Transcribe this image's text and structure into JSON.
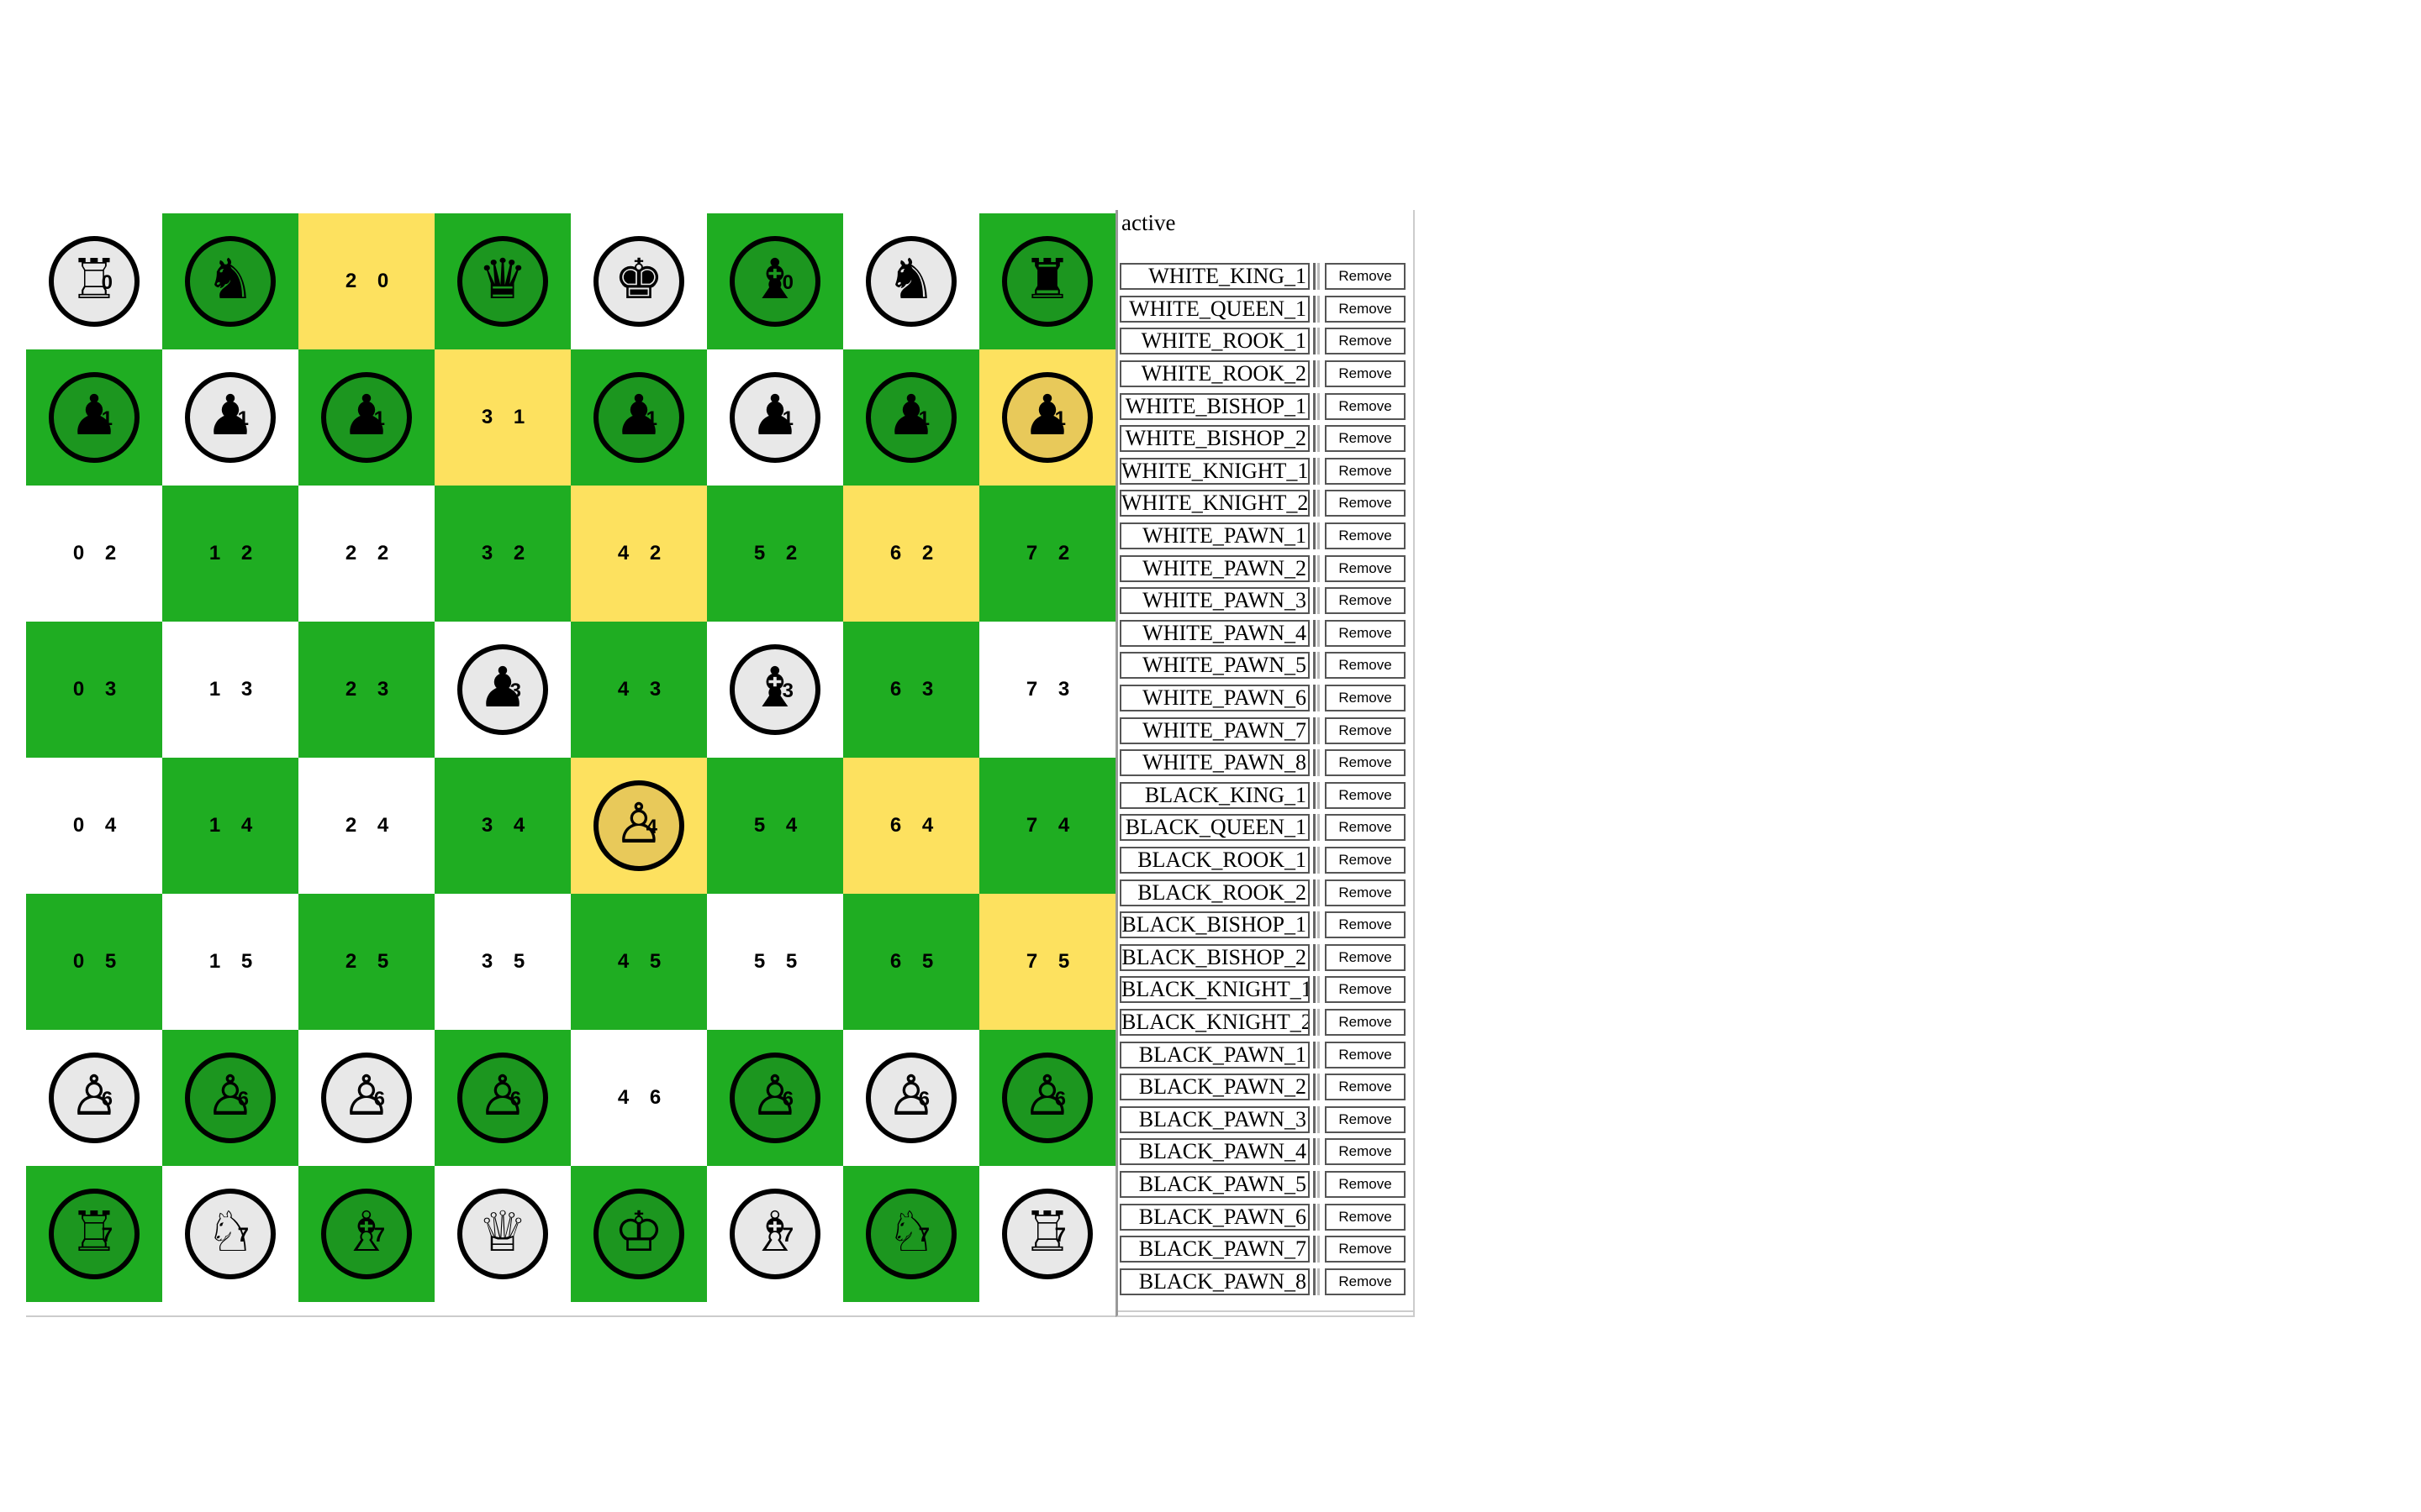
{
  "board": {
    "rows": [
      [
        {
          "bg": "white",
          "piece": {
            "glyph": "♖",
            "tone": "light",
            "tag": "0"
          }
        },
        {
          "bg": "green",
          "piece": {
            "glyph": "♞",
            "tone": "dark",
            "tag": ""
          }
        },
        {
          "bg": "yellow",
          "label": "2 0"
        },
        {
          "bg": "green",
          "piece": {
            "glyph": "♛",
            "tone": "dark",
            "tag": ""
          }
        },
        {
          "bg": "white",
          "piece": {
            "glyph": "♚",
            "tone": "light",
            "tag": ""
          }
        },
        {
          "bg": "green",
          "piece": {
            "glyph": "♝",
            "tone": "dark",
            "tag": "0"
          }
        },
        {
          "bg": "white",
          "piece": {
            "glyph": "♞",
            "tone": "light",
            "tag": ""
          }
        },
        {
          "bg": "green",
          "piece": {
            "glyph": "♜",
            "tone": "dark",
            "tag": ""
          }
        }
      ],
      [
        {
          "bg": "green",
          "piece": {
            "glyph": "♟",
            "tone": "dark",
            "tag": "1"
          }
        },
        {
          "bg": "white",
          "piece": {
            "glyph": "♟",
            "tone": "light",
            "tag": "1"
          }
        },
        {
          "bg": "green",
          "piece": {
            "glyph": "♟",
            "tone": "dark",
            "tag": "1"
          }
        },
        {
          "bg": "yellow",
          "label": "3 1"
        },
        {
          "bg": "green",
          "piece": {
            "glyph": "♟",
            "tone": "dark",
            "tag": "1"
          }
        },
        {
          "bg": "white",
          "piece": {
            "glyph": "♟",
            "tone": "light",
            "tag": "1"
          }
        },
        {
          "bg": "green",
          "piece": {
            "glyph": "♟",
            "tone": "dark",
            "tag": "1"
          }
        },
        {
          "bg": "yellow",
          "piece": {
            "glyph": "♟",
            "tone": "gold",
            "tag": "1"
          }
        }
      ],
      [
        {
          "bg": "white",
          "label": "0 2"
        },
        {
          "bg": "green",
          "label": "1 2"
        },
        {
          "bg": "white",
          "label": "2 2"
        },
        {
          "bg": "green",
          "label": "3 2"
        },
        {
          "bg": "yellow",
          "label": "4 2"
        },
        {
          "bg": "green",
          "label": "5 2"
        },
        {
          "bg": "yellow",
          "label": "6 2"
        },
        {
          "bg": "green",
          "label": "7 2"
        }
      ],
      [
        {
          "bg": "green",
          "label": "0 3"
        },
        {
          "bg": "white",
          "label": "1 3"
        },
        {
          "bg": "green",
          "label": "2 3"
        },
        {
          "bg": "white",
          "piece": {
            "glyph": "♟",
            "tone": "light",
            "tag": "3"
          }
        },
        {
          "bg": "green",
          "label": "4 3"
        },
        {
          "bg": "white",
          "piece": {
            "glyph": "♝",
            "tone": "light",
            "tag": "3"
          }
        },
        {
          "bg": "green",
          "label": "6 3"
        },
        {
          "bg": "white",
          "label": "7 3"
        }
      ],
      [
        {
          "bg": "white",
          "label": "0 4"
        },
        {
          "bg": "green",
          "label": "1 4"
        },
        {
          "bg": "white",
          "label": "2 4"
        },
        {
          "bg": "green",
          "label": "3 4"
        },
        {
          "bg": "yellow",
          "piece": {
            "glyph": "♙",
            "tone": "gold",
            "tag": "4"
          }
        },
        {
          "bg": "green",
          "label": "5 4"
        },
        {
          "bg": "yellow",
          "label": "6 4"
        },
        {
          "bg": "green",
          "label": "7 4"
        }
      ],
      [
        {
          "bg": "green",
          "label": "0 5"
        },
        {
          "bg": "white",
          "label": "1 5"
        },
        {
          "bg": "green",
          "label": "2 5"
        },
        {
          "bg": "white",
          "label": "3 5"
        },
        {
          "bg": "green",
          "label": "4 5"
        },
        {
          "bg": "white",
          "label": "5 5"
        },
        {
          "bg": "green",
          "label": "6 5"
        },
        {
          "bg": "yellow",
          "label": "7 5"
        }
      ],
      [
        {
          "bg": "white",
          "piece": {
            "glyph": "♙",
            "tone": "light",
            "tag": "6"
          }
        },
        {
          "bg": "green",
          "piece": {
            "glyph": "♙",
            "tone": "dark",
            "tag": "6"
          }
        },
        {
          "bg": "white",
          "piece": {
            "glyph": "♙",
            "tone": "light",
            "tag": "6"
          }
        },
        {
          "bg": "green",
          "piece": {
            "glyph": "♙",
            "tone": "dark",
            "tag": "6"
          }
        },
        {
          "bg": "white",
          "label": "4 6"
        },
        {
          "bg": "green",
          "piece": {
            "glyph": "♙",
            "tone": "dark",
            "tag": "6"
          }
        },
        {
          "bg": "white",
          "piece": {
            "glyph": "♙",
            "tone": "light",
            "tag": "6"
          }
        },
        {
          "bg": "green",
          "piece": {
            "glyph": "♙",
            "tone": "dark",
            "tag": "6"
          }
        }
      ],
      [
        {
          "bg": "green",
          "piece": {
            "glyph": "♖",
            "tone": "dark",
            "tag": "7"
          }
        },
        {
          "bg": "white",
          "piece": {
            "glyph": "♘",
            "tone": "light",
            "tag": "7"
          }
        },
        {
          "bg": "green",
          "piece": {
            "glyph": "♗",
            "tone": "dark",
            "tag": "7"
          }
        },
        {
          "bg": "white",
          "piece": {
            "glyph": "♕",
            "tone": "light",
            "tag": ""
          }
        },
        {
          "bg": "green",
          "piece": {
            "glyph": "♔",
            "tone": "dark",
            "tag": ""
          }
        },
        {
          "bg": "white",
          "piece": {
            "glyph": "♗",
            "tone": "light",
            "tag": "7"
          }
        },
        {
          "bg": "green",
          "piece": {
            "glyph": "♘",
            "tone": "dark",
            "tag": "7"
          }
        },
        {
          "bg": "white",
          "piece": {
            "glyph": "♖",
            "tone": "light",
            "tag": "7"
          }
        }
      ]
    ]
  },
  "colors": {
    "green": "#1fad22",
    "yellow": "#fde15f",
    "white": "#ffffff"
  },
  "panel": {
    "title": "active",
    "remove_label": "Remove",
    "pieces": [
      "WHITE_KING_1",
      "WHITE_QUEEN_1",
      "WHITE_ROOK_1",
      "WHITE_ROOK_2",
      "WHITE_BISHOP_1",
      "WHITE_BISHOP_2",
      "WHITE_KNIGHT_1",
      "WHITE_KNIGHT_2",
      "WHITE_PAWN_1",
      "WHITE_PAWN_2",
      "WHITE_PAWN_3",
      "WHITE_PAWN_4",
      "WHITE_PAWN_5",
      "WHITE_PAWN_6",
      "WHITE_PAWN_7",
      "WHITE_PAWN_8",
      "BLACK_KING_1",
      "BLACK_QUEEN_1",
      "BLACK_ROOK_1",
      "BLACK_ROOK_2",
      "BLACK_BISHOP_1",
      "BLACK_BISHOP_2",
      "BLACK_KNIGHT_1",
      "BLACK_KNIGHT_2",
      "BLACK_PAWN_1",
      "BLACK_PAWN_2",
      "BLACK_PAWN_3",
      "BLACK_PAWN_4",
      "BLACK_PAWN_5",
      "BLACK_PAWN_6",
      "BLACK_PAWN_7",
      "BLACK_PAWN_8"
    ]
  }
}
